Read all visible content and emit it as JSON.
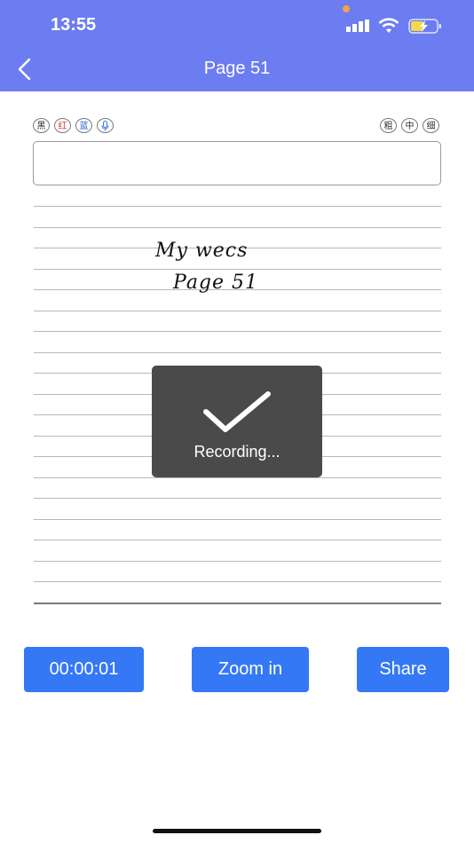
{
  "status_bar": {
    "time": "13:55"
  },
  "header": {
    "title": "Page 51",
    "color": "#6b7df0"
  },
  "pen_tools": {
    "colors": [
      {
        "label": "黑"
      },
      {
        "label": "红"
      },
      {
        "label": "蓝"
      }
    ],
    "widths": [
      {
        "label": "粗"
      },
      {
        "label": "中"
      },
      {
        "label": "细"
      }
    ]
  },
  "note_input": {
    "value": "",
    "placeholder": ""
  },
  "handwriting": {
    "line1": "My wecs",
    "line2": "Page 51"
  },
  "toast": {
    "text": "Recording..."
  },
  "buttons": {
    "timer": "00:00:01",
    "zoom": "Zoom in",
    "share": "Share",
    "color": "#3478f6"
  }
}
